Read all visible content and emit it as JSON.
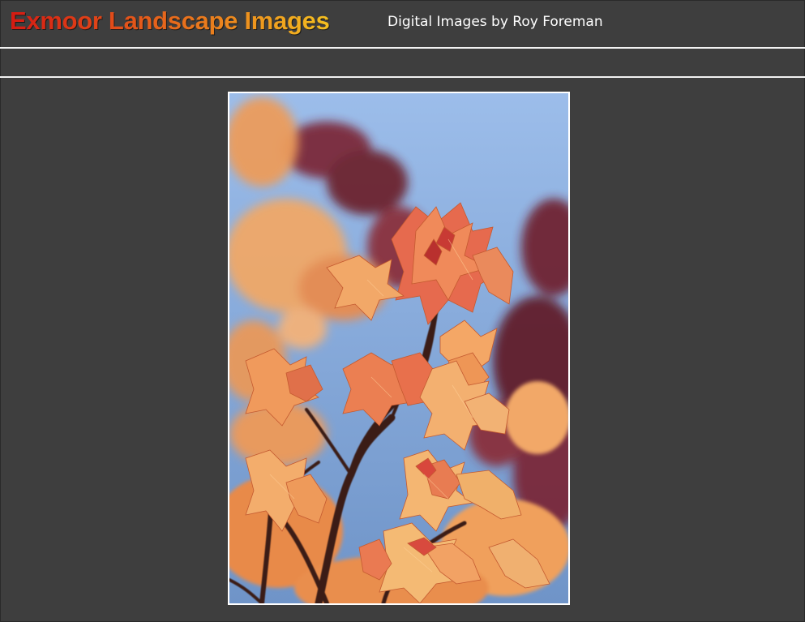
{
  "header": {
    "title": "Exmoor Landscape Images",
    "subtitle": "Digital Images by Roy Foreman"
  },
  "main": {
    "photo_subject": "orange-red-maple-leaves-against-blue-sky"
  },
  "colors": {
    "background": "#3e3e3e",
    "rule": "#f2f2f2",
    "title_gradient_start": "#d51a12",
    "title_gradient_end": "#f4c020",
    "subtitle": "#ffffff",
    "sky": "#8fb4e6",
    "leaf_orange": "#f2a25a",
    "leaf_red": "#e06048",
    "leaf_dark": "#6e1c2a"
  }
}
